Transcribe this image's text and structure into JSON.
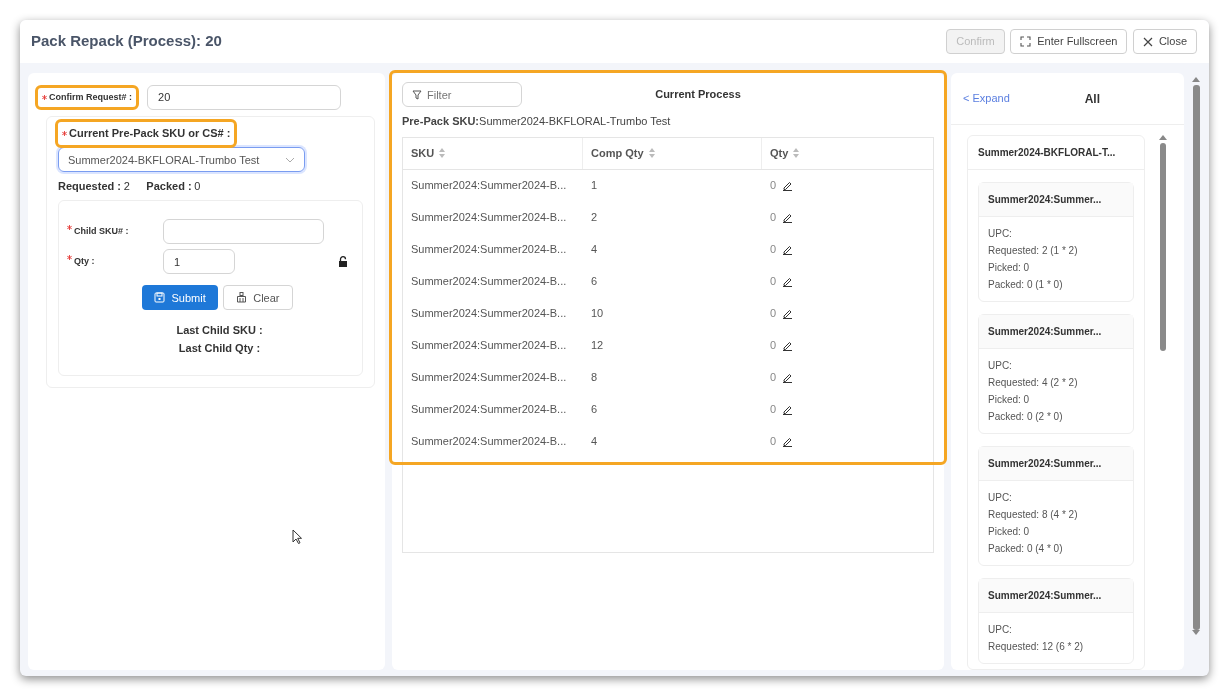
{
  "dialog": {
    "title": "Pack Repack (Process): 20",
    "buttons": [
      {
        "label": "Confirm",
        "kind": "confirm",
        "disabled": true
      },
      {
        "label": "Enter Fullscreen",
        "kind": "fullscreen",
        "disabled": false
      },
      {
        "label": "Close",
        "kind": "close",
        "disabled": false
      }
    ]
  },
  "request": {
    "label": "Confirm Request# :",
    "required": true,
    "highlighted": true,
    "value": "20"
  },
  "prepack": {
    "label": "Current Pre-Pack SKU or CS# :",
    "required": true,
    "highlighted": true,
    "value": "Summer2024-BKFLORAL-Trumbo Test"
  },
  "summary": [
    {
      "label": "Requested :",
      "value": "2"
    },
    {
      "label": "Packed :",
      "value": "0"
    }
  ],
  "child_form": {
    "fields": [
      {
        "label": "Child SKU# :",
        "required": true
      },
      {
        "label": "Qty :",
        "required": true,
        "value": "1",
        "locked": false
      }
    ],
    "buttons": [
      {
        "label": "Submit",
        "kind": "primary"
      },
      {
        "label": "Clear",
        "kind": "secondary"
      }
    ],
    "last": [
      "Last Child SKU :",
      "Last Child Qty :"
    ]
  },
  "process": {
    "highlighted": true,
    "filter": {
      "placeholder": "Filter"
    },
    "title": "Current Process",
    "prepack_line": "**Pre-Pack SKU:**Summer2024-BKFLORAL-Trumbo Test",
    "table": {
      "columns": [
        "SKU",
        "Comp Qty",
        "Qty"
      ],
      "rows": [
        {
          "sku": "Summer2024:Summer2024-B...",
          "comp_qty": "1",
          "qty": "0"
        },
        {
          "sku": "Summer2024:Summer2024-B...",
          "comp_qty": "2",
          "qty": "0"
        },
        {
          "sku": "Summer2024:Summer2024-B...",
          "comp_qty": "4",
          "qty": "0"
        },
        {
          "sku": "Summer2024:Summer2024-B...",
          "comp_qty": "6",
          "qty": "0"
        },
        {
          "sku": "Summer2024:Summer2024-B...",
          "comp_qty": "10",
          "qty": "0"
        },
        {
          "sku": "Summer2024:Summer2024-B...",
          "comp_qty": "12",
          "qty": "0"
        },
        {
          "sku": "Summer2024:Summer2024-B...",
          "comp_qty": "8",
          "qty": "0"
        },
        {
          "sku": "Summer2024:Summer2024-B...",
          "comp_qty": "6",
          "qty": "0"
        },
        {
          "sku": "Summer2024:Summer2024-B...",
          "comp_qty": "4",
          "qty": "0"
        }
      ]
    }
  },
  "overview": {
    "expand": "< Expand",
    "title": "All",
    "group": {
      "title": "Summer2024-BKFLORAL-T...",
      "items": [
        {
          "title": "Summer2024:Summer...",
          "lines": [
            "UPC:",
            "Requested: 2 (1 * 2)",
            "Picked: 0",
            "Packed: 0 (1 * 0)"
          ]
        },
        {
          "title": "Summer2024:Summer...",
          "lines": [
            "UPC:",
            "Requested: 4 (2 * 2)",
            "Picked: 0",
            "Packed: 0 (2 * 0)"
          ]
        },
        {
          "title": "Summer2024:Summer...",
          "lines": [
            "UPC:",
            "Requested: 8 (4 * 2)",
            "Picked: 0",
            "Packed: 0 (4 * 0)"
          ]
        },
        {
          "title": "Summer2024:Summer...",
          "lines": [
            "UPC:",
            "Requested: 12 (6 * 2)"
          ]
        }
      ]
    }
  }
}
